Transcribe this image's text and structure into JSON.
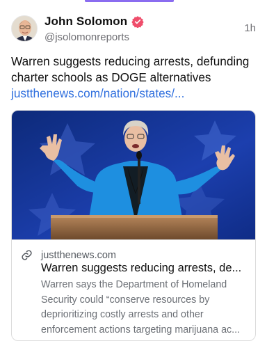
{
  "post": {
    "author": {
      "display_name": "John Solomon",
      "handle": "@jsolomonreports",
      "verified_icon": "verified-badge-icon",
      "verified_color": "#ef4d6b"
    },
    "timestamp": "1h",
    "text": "Warren suggests reducing arrests, defunding charter schools as DOGE alternatives",
    "link_text": "justthenews.com/nation/states/...",
    "link_color": "#2f6fde"
  },
  "link_card": {
    "domain": "justthenews.com",
    "title": "Warren suggests reducing arrests, de...",
    "description_lines": [
      "Warren says the Department of Homeland",
      "Security could “conserve resources by",
      "deprioritizing costly arrests and other",
      "enforcement actions targeting marijuana ac..."
    ],
    "image_icon": "speaker-at-podium-photo"
  },
  "colors": {
    "accent": "#8a6cf0",
    "muted_text": "#6e6e73"
  }
}
